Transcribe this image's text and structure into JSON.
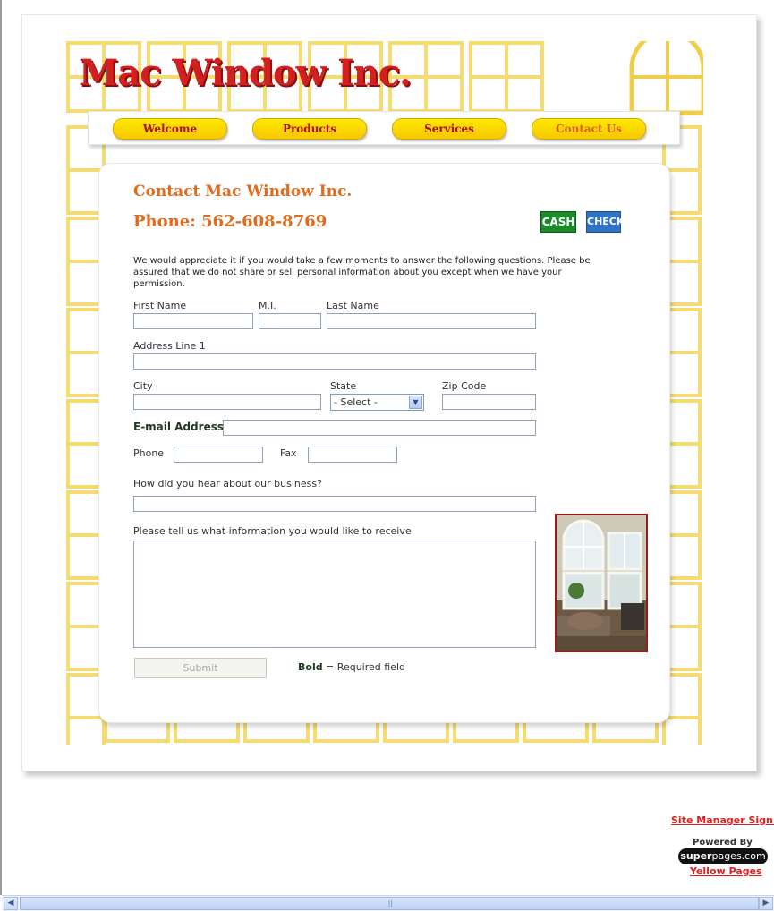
{
  "site": {
    "logo_text": "Mac Window Inc."
  },
  "nav": {
    "items": [
      {
        "label": "Welcome"
      },
      {
        "label": "Products"
      },
      {
        "label": "Services"
      },
      {
        "label": "Contact Us",
        "active": true
      }
    ]
  },
  "content": {
    "title": "Contact Mac Window Inc.",
    "phone": "Phone: 562-608-8769",
    "payment_badges": [
      "CASH",
      "CHECK"
    ],
    "intro": "We would appreciate it if you would take a few moments to answer the following questions. Please be assured that we do not share or sell personal information about you except when we have your permission."
  },
  "form": {
    "first_name_label": "First Name",
    "mi_label": "M.I.",
    "last_name_label": "Last Name",
    "address_label": "Address Line 1",
    "city_label": "City",
    "state_label": "State",
    "state_selected": "- Select -",
    "zip_label": "Zip Code",
    "email_label": "E-mail Address",
    "phone_label": "Phone",
    "fax_label": "Fax",
    "hear_label": "How did you hear about our business?",
    "info_label": "Please tell us what information you would like to receive",
    "submit_label": "Submit",
    "legend_bold": "Bold",
    "legend_rest": " = Required field"
  },
  "footer": {
    "site_manager": "Site Manager Sign In",
    "powered_by": "Powered By",
    "superpages_a": "super",
    "superpages_b": "pages.com",
    "yellow_pages": "Yellow Pages"
  },
  "colors": {
    "accent_orange": "#e06b1c",
    "logo_red": "#d21f1f",
    "nav_yellow": "#ffe800",
    "lattice_yellow": "#f4dc72"
  }
}
